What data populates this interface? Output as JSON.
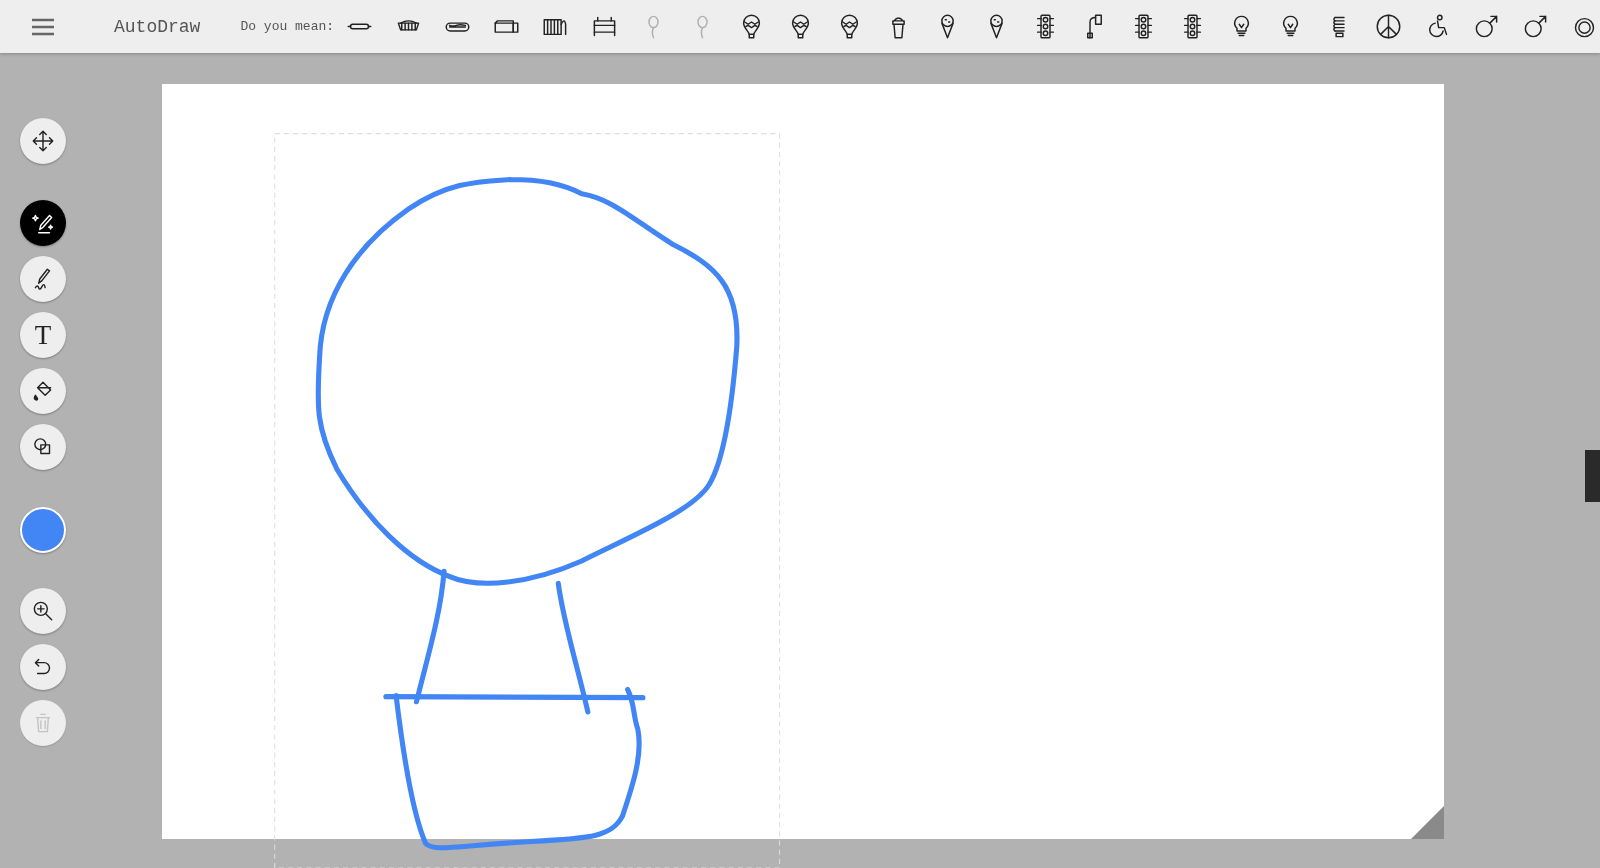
{
  "app": {
    "title": "AutoDraw"
  },
  "suggestions": {
    "label": "Do you mean:",
    "items": [
      {
        "kind": "bun",
        "faded": false
      },
      {
        "kind": "basket",
        "faded": false
      },
      {
        "kind": "hotdog",
        "faded": false
      },
      {
        "kind": "box",
        "faded": false
      },
      {
        "kind": "radiator",
        "faded": false
      },
      {
        "kind": "bed",
        "faded": false
      },
      {
        "kind": "balloon",
        "faded": true
      },
      {
        "kind": "balloon",
        "faded": true
      },
      {
        "kind": "airballoon",
        "faded": false
      },
      {
        "kind": "airballoon",
        "faded": false
      },
      {
        "kind": "airballoon",
        "faded": false
      },
      {
        "kind": "icecream",
        "faded": false
      },
      {
        "kind": "cone",
        "faded": false
      },
      {
        "kind": "cone",
        "faded": false
      },
      {
        "kind": "trafficlight",
        "faded": false
      },
      {
        "kind": "streetlamp",
        "faded": false
      },
      {
        "kind": "trafficlight",
        "faded": false
      },
      {
        "kind": "trafficlight",
        "faded": false
      },
      {
        "kind": "bulb",
        "faded": false
      },
      {
        "kind": "bulb",
        "faded": false
      },
      {
        "kind": "cfl",
        "faded": false
      },
      {
        "kind": "peace",
        "faded": false
      },
      {
        "kind": "wheelchair",
        "faded": false
      },
      {
        "kind": "male",
        "faded": false
      },
      {
        "kind": "male",
        "faded": false
      },
      {
        "kind": "ring",
        "faded": false
      }
    ]
  },
  "tools": [
    {
      "kind": "move",
      "selected": false,
      "disabled": false
    },
    {
      "kind": "autodraw",
      "selected": true,
      "disabled": false
    },
    {
      "kind": "draw",
      "selected": false,
      "disabled": false
    },
    {
      "kind": "text",
      "glyph": "T",
      "selected": false,
      "disabled": false
    },
    {
      "kind": "fill",
      "selected": false,
      "disabled": false
    },
    {
      "kind": "shape",
      "selected": false,
      "disabled": false
    },
    {
      "kind": "color",
      "color": "#4285f4",
      "selected": false,
      "disabled": false
    },
    {
      "kind": "zoom",
      "selected": false,
      "disabled": false
    },
    {
      "kind": "undo",
      "selected": false,
      "disabled": false
    },
    {
      "kind": "delete",
      "selected": false,
      "disabled": true
    }
  ]
}
